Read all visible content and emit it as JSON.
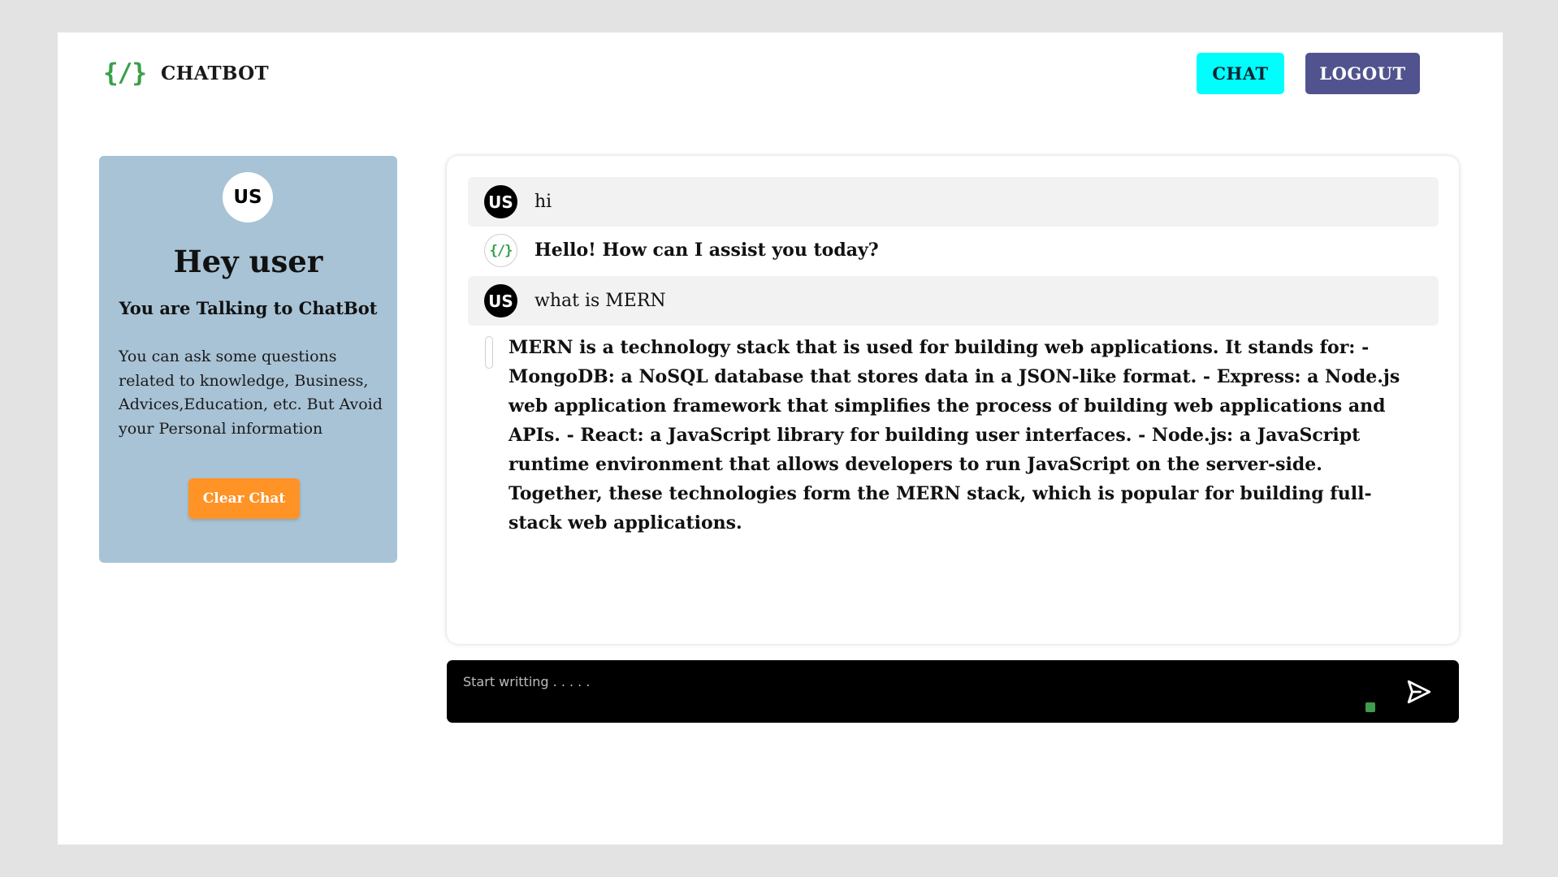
{
  "header": {
    "logo": "{/}",
    "brand": "CHATBOT",
    "chat_label": "CHAT",
    "logout_label": "LOGOUT"
  },
  "sidebar": {
    "avatar_initials": "US",
    "greeting": "Hey user",
    "subtitle": "You are Talking to ChatBot",
    "description": "You can ask some questions related to knowledge, Business, Advices,Education, etc. But Avoid your Personal information",
    "clear_label": "Clear Chat"
  },
  "chat": {
    "messages": [
      {
        "role": "user",
        "avatar": "US",
        "text": "hi"
      },
      {
        "role": "assistant",
        "avatar": "{/}",
        "text": "Hello! How can I assist you today?"
      },
      {
        "role": "user",
        "avatar": "US",
        "text": "what is MERN"
      },
      {
        "role": "assistant",
        "avatar": "{/}",
        "text": "MERN is a technology stack that is used for building web applications. It stands for: - MongoDB: a NoSQL database that stores data in a JSON-like format. - Express: a Node.js web application framework that simplifies the process of building web applications and APIs. - React: a JavaScript library for building user interfaces. - Node.js: a JavaScript runtime environment that allows developers to run JavaScript on the server-side. Together, these technologies form the MERN stack, which is popular for building full-stack web applications."
      }
    ]
  },
  "input": {
    "placeholder": "Start writting . . . . .",
    "value": ""
  },
  "icons": {
    "send": "send-icon",
    "logo": "code-brackets-icon",
    "status": "status-dot-icon"
  },
  "colors": {
    "background": "#e3e3e3",
    "chat_button": "#00fffc",
    "logout_button": "#51538f",
    "sidebar": "#a8c3d6",
    "clear_button": "#ff9326",
    "logo_green": "#3aa04a",
    "input_bar": "#000000",
    "user_message_bg": "#f2f2f2"
  }
}
